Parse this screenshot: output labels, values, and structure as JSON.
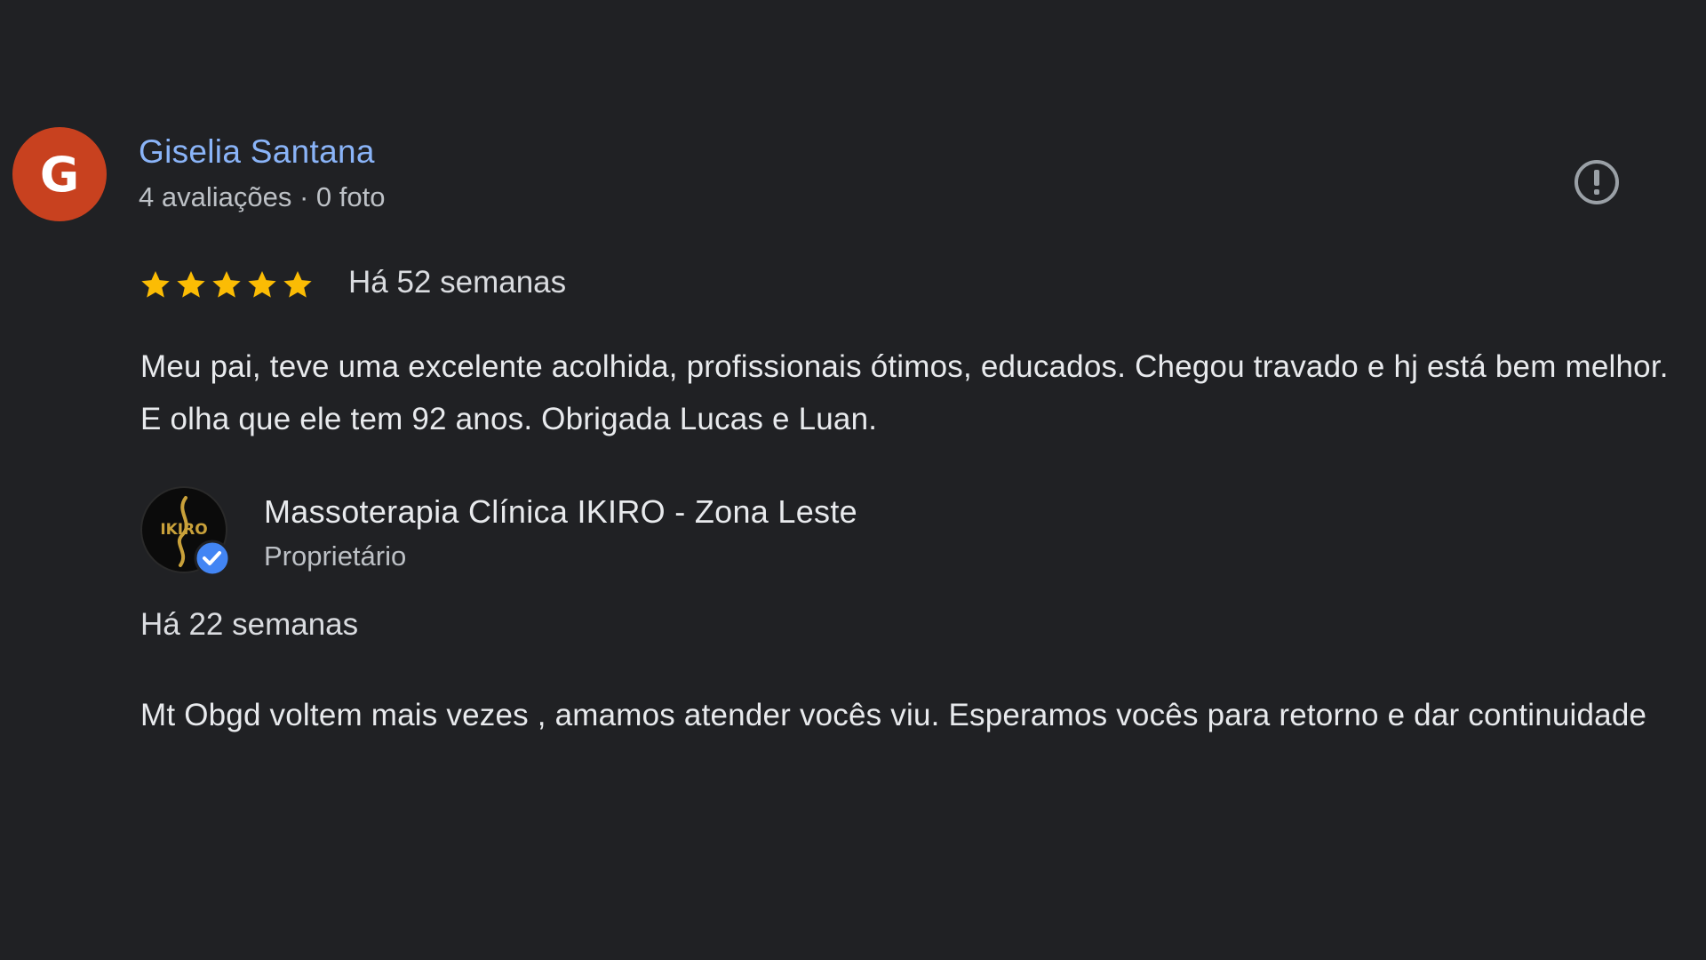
{
  "review": {
    "avatar_letter": "G",
    "avatar_color": "#c8411f",
    "reviewer_name": "Giselia Santana",
    "reviewer_meta": "4 avaliações · 0 foto",
    "rating": 5,
    "rating_max": 5,
    "star_color": "#fbbc04",
    "time": "Há 52 semanas",
    "text": "Meu pai, teve uma excelente acolhida, profissionais ótimos, educados. Chegou travado e hj está bem melhor. E olha que ele tem 92 anos. Obrigada Lucas e Luan.",
    "report_icon": "report-flag-icon"
  },
  "owner_reply": {
    "logo_text": "IKIRO",
    "owner_name": "Massoterapia Clínica IKIRO - Zona Leste",
    "owner_role": "Proprietário",
    "verified_icon": "verified-check-icon",
    "verified_color": "#4285f4",
    "time": "Há 22 semanas",
    "text": "Mt Obgd voltem mais vezes , amamos atender vocês viu. Esperamos vocês para retorno e dar continuidade"
  },
  "colors": {
    "background": "#202124",
    "name_link": "#8ab4f8",
    "text": "#e8eaed",
    "secondary_text": "#bdc1c6"
  }
}
